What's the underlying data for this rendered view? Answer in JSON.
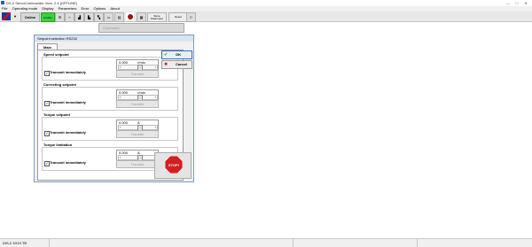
{
  "window": {
    "title": "DS-2 ServoCommander Vers. 2.4 [OFFLINE]",
    "buttons": [
      "—",
      "□",
      "✕"
    ]
  },
  "menu": [
    "File",
    "Operating mode",
    "Display",
    "Parameters",
    "Error",
    "Options",
    "About"
  ],
  "toolbar": {
    "online_label": "Online",
    "enable_label": "Enable",
    "parameter_label": "Store Parameter",
    "reset_label": "Reset",
    "icons": [
      "dropdown-arrow-icon",
      "motor-icon",
      "oscilloscope-icon",
      "chart-icon",
      "chart2-icon",
      "chart3-icon",
      "folder-icon",
      "record-icon",
      "io-icon",
      "refresh-icon"
    ]
  },
  "ghost_window": {
    "title": "Command"
  },
  "dialog": {
    "title": "Setpoint selection RS232",
    "tab": "Main",
    "ok_label": "OK",
    "cancel_label": "Cancel",
    "stop_label": "STOP!",
    "groups": [
      {
        "title": "Speed setpoint",
        "value": "0.000",
        "unit": "r/min",
        "checkbox_label": "Transmit immediately",
        "checked": true,
        "transfer_label": "Transfer"
      },
      {
        "title": "Correcting setpoint",
        "value": "0.000",
        "unit": "r/min",
        "checkbox_label": "Transmit immediately",
        "checked": true,
        "transfer_label": "Transfer"
      },
      {
        "title": "Torque setpoint",
        "value": "0.000",
        "unit": "A",
        "checkbox_label": "Transmit immediately",
        "checked": true,
        "transfer_label": "Transfer"
      },
      {
        "title": "Torque limitation",
        "value": "0.000",
        "unit": "A",
        "checkbox_label": "Transmit immediately",
        "checked": true,
        "transfer_label": "Transfer"
      }
    ]
  },
  "statusbar": {
    "device": "DIS-2 1H10 TB"
  },
  "colors": {
    "enable_green": "#3cd23c",
    "stop_red": "#d21f1f",
    "dialog_border": "#7a9cc0"
  }
}
